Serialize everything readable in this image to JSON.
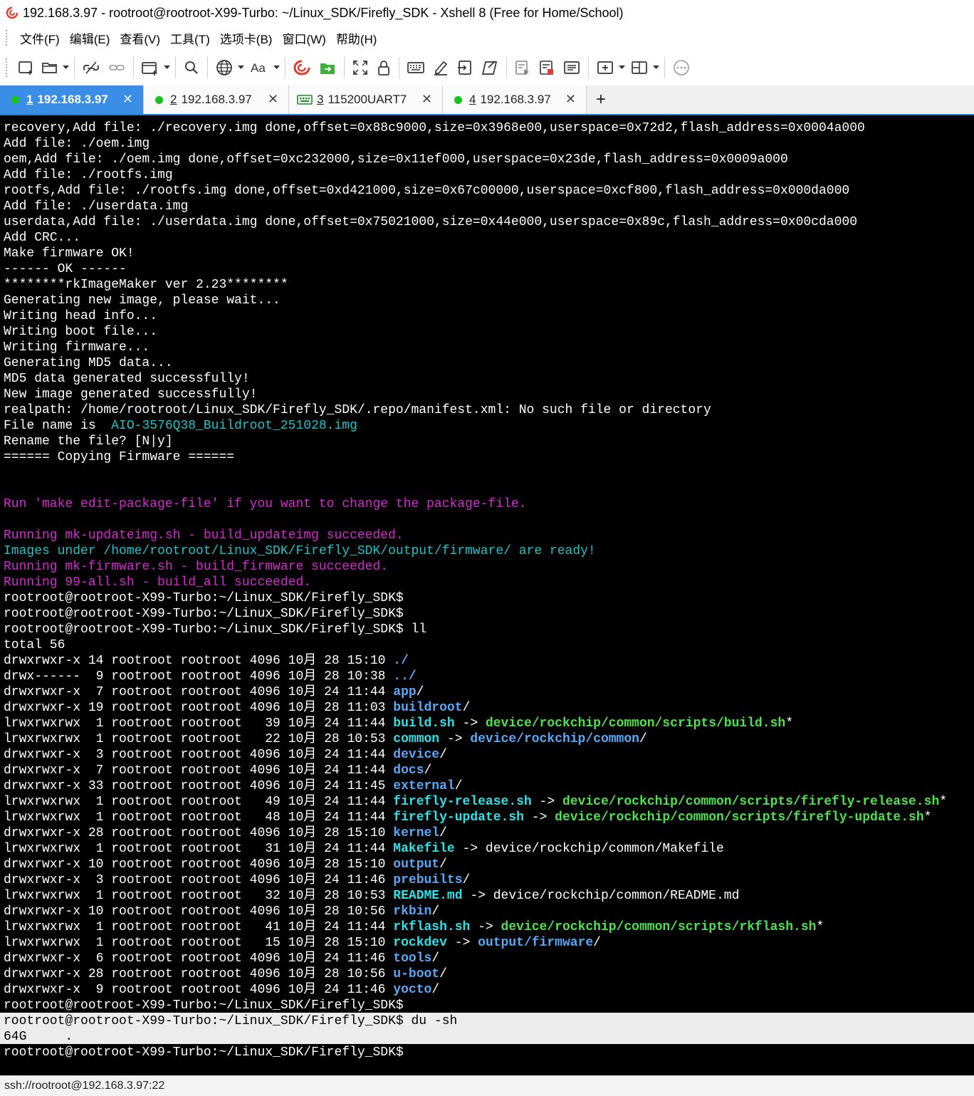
{
  "window": {
    "title": "192.168.3.97 - rootroot@rootroot-X99-Turbo: ~/Linux_SDK/Firefly_SDK - Xshell 8 (Free for Home/School)"
  },
  "menu": [
    "文件(F)",
    "编辑(E)",
    "查看(V)",
    "工具(T)",
    "选项卡(B)",
    "窗口(W)",
    "帮助(H)"
  ],
  "toolbar_icons": [
    "new-session-icon",
    "open-folder-icon",
    "disconnect-icon",
    "reconnect-icon",
    "new-tab-window-icon",
    "find-icon",
    "globe-icon",
    "font-icon",
    "xshell-logo-icon",
    "xftp-icon",
    "fullscreen-icon",
    "lock-icon",
    "keyboard-icon",
    "highlight-icon",
    "script-icon",
    "compose-icon",
    "log-icon",
    "record-icon",
    "transfer-icon",
    "new-pane-icon",
    "layout-icon",
    "chat-icon"
  ],
  "tabs": [
    {
      "num": "1",
      "label": "192.168.3.97",
      "type": "ssh",
      "active": true
    },
    {
      "num": "2",
      "label": "192.168.3.97",
      "type": "ssh",
      "active": false
    },
    {
      "num": "3",
      "label": "115200UART7",
      "type": "serial",
      "active": false
    },
    {
      "num": "4",
      "label": "192.168.3.97",
      "type": "ssh",
      "active": false
    }
  ],
  "colors": {
    "tab_active": "#3a8ee6",
    "status_connected": "#16c21b",
    "term_magenta": "#d52ad0",
    "term_cyan": "#1fc3c8",
    "term_dir_blue": "#58a8f8",
    "term_exec_green": "#4ee34e",
    "term_link_cyan": "#2ee2e8"
  },
  "terminal": {
    "lines": [
      [
        {
          "t": "recovery,Add file: ./recovery.img done,offset=0x88c9000,size=0x3968e00,userspace=0x72d2,flash_address=0x0004a000"
        }
      ],
      [
        {
          "t": "Add file: ./oem.img"
        }
      ],
      [
        {
          "t": "oem,Add file: ./oem.img done,offset=0xc232000,size=0x11ef000,userspace=0x23de,flash_address=0x0009a000"
        }
      ],
      [
        {
          "t": "Add file: ./rootfs.img"
        }
      ],
      [
        {
          "t": "rootfs,Add file: ./rootfs.img done,offset=0xd421000,size=0x67c00000,userspace=0xcf800,flash_address=0x000da000"
        }
      ],
      [
        {
          "t": "Add file: ./userdata.img"
        }
      ],
      [
        {
          "t": "userdata,Add file: ./userdata.img done,offset=0x75021000,size=0x44e000,userspace=0x89c,flash_address=0x00cda000"
        }
      ],
      [
        {
          "t": "Add CRC..."
        }
      ],
      [
        {
          "t": "Make firmware OK!"
        }
      ],
      [
        {
          "t": "------ OK ------"
        }
      ],
      [
        {
          "t": "********rkImageMaker ver 2.23********"
        }
      ],
      [
        {
          "t": "Generating new image, please wait..."
        }
      ],
      [
        {
          "t": "Writing head info..."
        }
      ],
      [
        {
          "t": "Writing boot file..."
        }
      ],
      [
        {
          "t": "Writing firmware..."
        }
      ],
      [
        {
          "t": "Generating MD5 data..."
        }
      ],
      [
        {
          "t": "MD5 data generated successfully!"
        }
      ],
      [
        {
          "t": "New image generated successfully!"
        }
      ],
      [
        {
          "t": "realpath: /home/rootroot/Linux_SDK/Firefly_SDK/.repo/manifest.xml: No such file or directory"
        }
      ],
      [
        {
          "t": "File name is  "
        },
        {
          "t": "AIO-3576Q38_Buildroot_251028.img",
          "c": "c-cyan"
        }
      ],
      [
        {
          "t": "Rename the file? [N|y]"
        }
      ],
      [
        {
          "t": "====== Copying Firmware ======"
        }
      ],
      [],
      [],
      [
        {
          "t": "Run 'make edit-package-file' if you want to change the package-file.",
          "c": "c-magenta"
        }
      ],
      [],
      [
        {
          "t": "Running mk-updateimg.sh - build_updateimg succeeded.",
          "c": "c-magenta"
        }
      ],
      [
        {
          "t": "Images under /home/rootroot/Linux_SDK/Firefly_SDK/output/firmware/ are ready!",
          "c": "c-cyan"
        }
      ],
      [
        {
          "t": "Running mk-firmware.sh - build_firmware succeeded.",
          "c": "c-magenta"
        }
      ],
      [
        {
          "t": "Running 99-all.sh - build_all succeeded.",
          "c": "c-magenta"
        }
      ],
      [
        {
          "t": "rootroot@rootroot-X99-Turbo:~/Linux_SDK/Firefly_SDK$"
        }
      ],
      [
        {
          "t": "rootroot@rootroot-X99-Turbo:~/Linux_SDK/Firefly_SDK$"
        }
      ],
      [
        {
          "t": "rootroot@rootroot-X99-Turbo:~/Linux_SDK/Firefly_SDK$ ll"
        }
      ],
      [
        {
          "t": "total 56"
        }
      ],
      [
        {
          "t": "drwxrwxr-x 14 rootroot rootroot 4096 10月 28 15:10 "
        },
        {
          "t": "./",
          "c": "c-blue"
        }
      ],
      [
        {
          "t": "drwx------  9 rootroot rootroot 4096 10月 28 10:38 "
        },
        {
          "t": "../",
          "c": "c-blue"
        }
      ],
      [
        {
          "t": "drwxrwxr-x  7 rootroot rootroot 4096 10月 24 11:44 "
        },
        {
          "t": "app",
          "c": "c-blue"
        },
        {
          "t": "/"
        }
      ],
      [
        {
          "t": "drwxrwxr-x 19 rootroot rootroot 4096 10月 28 11:03 "
        },
        {
          "t": "buildroot",
          "c": "c-blue"
        },
        {
          "t": "/"
        }
      ],
      [
        {
          "t": "lrwxrwxrwx  1 rootroot rootroot   39 10月 24 11:44 "
        },
        {
          "t": "build.sh",
          "c": "c-cyanb"
        },
        {
          "t": " -> "
        },
        {
          "t": "device/rockchip/common/scripts/build.sh",
          "c": "c-green"
        },
        {
          "t": "*"
        }
      ],
      [
        {
          "t": "lrwxrwxrwx  1 rootroot rootroot   22 10月 28 10:53 "
        },
        {
          "t": "common",
          "c": "c-cyanb"
        },
        {
          "t": " -> "
        },
        {
          "t": "device/rockchip/common",
          "c": "c-blue"
        },
        {
          "t": "/"
        }
      ],
      [
        {
          "t": "drwxrwxr-x  3 rootroot rootroot 4096 10月 24 11:44 "
        },
        {
          "t": "device",
          "c": "c-blue"
        },
        {
          "t": "/"
        }
      ],
      [
        {
          "t": "drwxrwxr-x  7 rootroot rootroot 4096 10月 24 11:44 "
        },
        {
          "t": "docs",
          "c": "c-blue"
        },
        {
          "t": "/"
        }
      ],
      [
        {
          "t": "drwxrwxr-x 33 rootroot rootroot 4096 10月 24 11:45 "
        },
        {
          "t": "external",
          "c": "c-blue"
        },
        {
          "t": "/"
        }
      ],
      [
        {
          "t": "lrwxrwxrwx  1 rootroot rootroot   49 10月 24 11:44 "
        },
        {
          "t": "firefly-release.sh",
          "c": "c-cyanb"
        },
        {
          "t": " -> "
        },
        {
          "t": "device/rockchip/common/scripts/firefly-release.sh",
          "c": "c-green"
        },
        {
          "t": "*"
        }
      ],
      [
        {
          "t": "lrwxrwxrwx  1 rootroot rootroot   48 10月 24 11:44 "
        },
        {
          "t": "firefly-update.sh",
          "c": "c-cyanb"
        },
        {
          "t": " -> "
        },
        {
          "t": "device/rockchip/common/scripts/firefly-update.sh",
          "c": "c-green"
        },
        {
          "t": "*"
        }
      ],
      [
        {
          "t": "drwxrwxr-x 28 rootroot rootroot 4096 10月 28 15:10 "
        },
        {
          "t": "kernel",
          "c": "c-blue"
        },
        {
          "t": "/"
        }
      ],
      [
        {
          "t": "lrwxrwxrwx  1 rootroot rootroot   31 10月 24 11:44 "
        },
        {
          "t": "Makefile",
          "c": "c-cyanb"
        },
        {
          "t": " -> device/rockchip/common/Makefile"
        }
      ],
      [
        {
          "t": "drwxrwxr-x 10 rootroot rootroot 4096 10月 28 15:10 "
        },
        {
          "t": "output",
          "c": "c-blue"
        },
        {
          "t": "/"
        }
      ],
      [
        {
          "t": "drwxrwxr-x  3 rootroot rootroot 4096 10月 24 11:46 "
        },
        {
          "t": "prebuilts",
          "c": "c-blue"
        },
        {
          "t": "/"
        }
      ],
      [
        {
          "t": "lrwxrwxrwx  1 rootroot rootroot   32 10月 28 10:53 "
        },
        {
          "t": "README.md",
          "c": "c-cyanb"
        },
        {
          "t": " -> device/rockchip/common/README.md"
        }
      ],
      [
        {
          "t": "drwxrwxr-x 10 rootroot rootroot 4096 10月 28 10:56 "
        },
        {
          "t": "rkbin",
          "c": "c-blue"
        },
        {
          "t": "/"
        }
      ],
      [
        {
          "t": "lrwxrwxrwx  1 rootroot rootroot   41 10月 24 11:44 "
        },
        {
          "t": "rkflash.sh",
          "c": "c-cyanb"
        },
        {
          "t": " -> "
        },
        {
          "t": "device/rockchip/common/scripts/rkflash.sh",
          "c": "c-green"
        },
        {
          "t": "*"
        }
      ],
      [
        {
          "t": "lrwxrwxrwx  1 rootroot rootroot   15 10月 28 15:10 "
        },
        {
          "t": "rockdev",
          "c": "c-cyanb"
        },
        {
          "t": " -> "
        },
        {
          "t": "output/firmware",
          "c": "c-blue"
        },
        {
          "t": "/"
        }
      ],
      [
        {
          "t": "drwxrwxr-x  6 rootroot rootroot 4096 10月 24 11:46 "
        },
        {
          "t": "tools",
          "c": "c-blue"
        },
        {
          "t": "/"
        }
      ],
      [
        {
          "t": "drwxrwxr-x 28 rootroot rootroot 4096 10月 28 10:56 "
        },
        {
          "t": "u-boot",
          "c": "c-blue"
        },
        {
          "t": "/"
        }
      ],
      [
        {
          "t": "drwxrwxr-x  9 rootroot rootroot 4096 10月 24 11:46 "
        },
        {
          "t": "yocto",
          "c": "c-blue"
        },
        {
          "t": "/"
        }
      ],
      [
        {
          "t": "rootroot@rootroot-X99-Turbo:~/Linux_SDK/Firefly_SDK$"
        }
      ],
      [
        {
          "t": "rootroot@rootroot-X99-Turbo:~/Linux_SDK/Firefly_SDK$ du -sh",
          "sel": true
        }
      ],
      [
        {
          "t": "64G     .",
          "sel": true
        }
      ],
      [
        {
          "t": "rootroot@rootroot-X99-Turbo:~/Linux_SDK/Firefly_SDK$"
        }
      ]
    ]
  },
  "status": {
    "connection": "ssh://rootroot@192.168.3.97:22"
  }
}
